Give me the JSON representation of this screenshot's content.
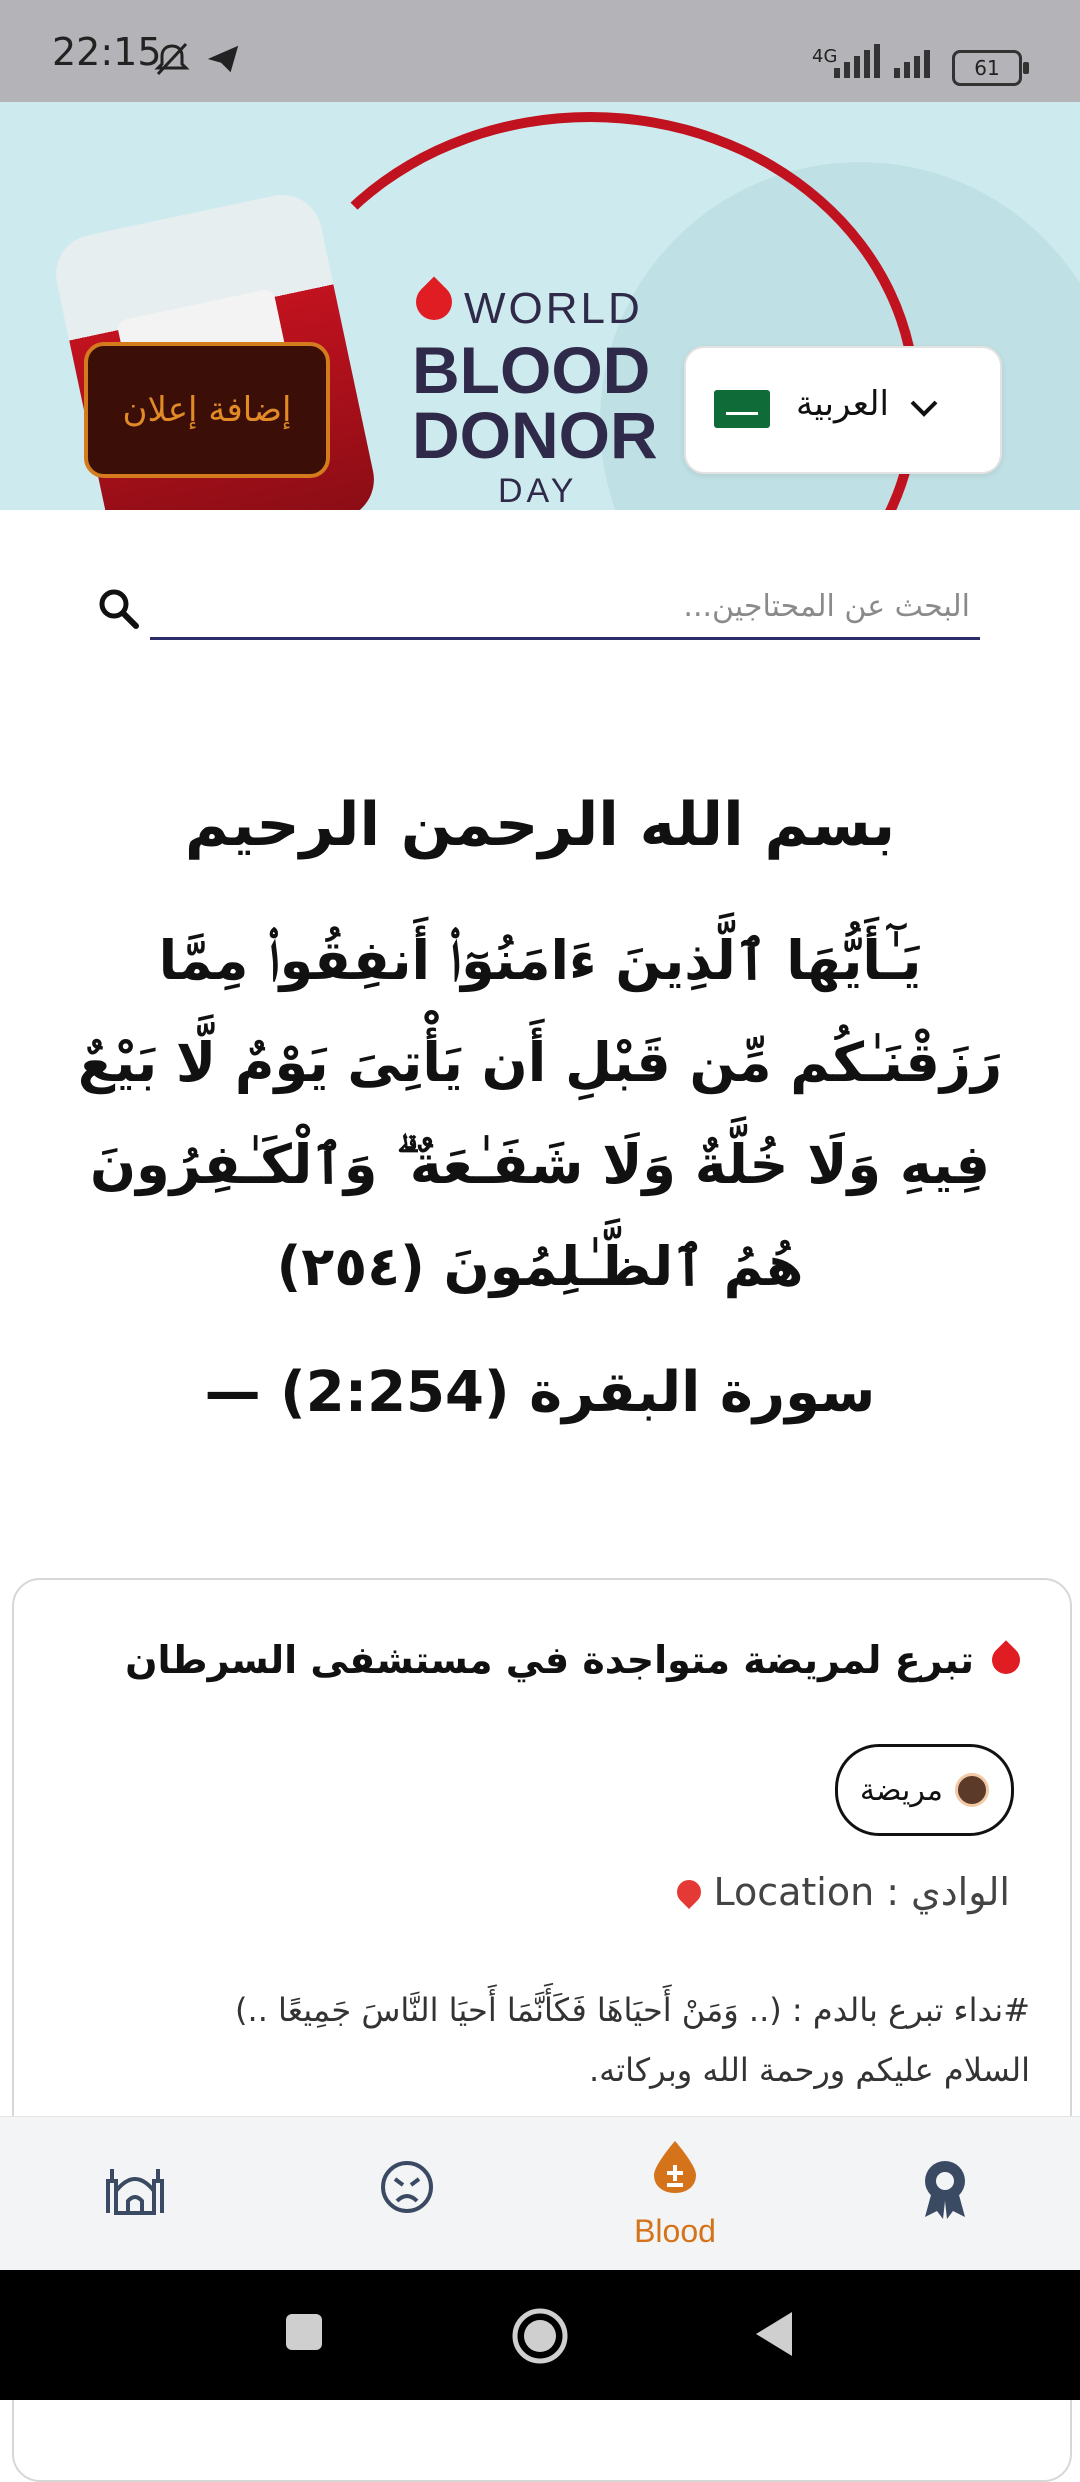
{
  "status_bar": {
    "time": "22:15",
    "network": "4G",
    "battery": "61"
  },
  "banner": {
    "add_ad_label": "إضافة إعلان",
    "language": "العربية",
    "logo": {
      "line1": "WORLD",
      "line2": "BLOOD",
      "line3": "DONOR",
      "line4": "DAY"
    }
  },
  "search": {
    "placeholder": "البحث عن المحتاجين..."
  },
  "verse": {
    "bismillah": "بسم الله الرحمن الرحيم",
    "text": "يَـٰٓأَيُّهَا ٱلَّذِينَ ءَامَنُوٓا۟ أَنفِقُوا۟ مِمَّا رَزَقْنَـٰكُم مِّن قَبْلِ أَن يَأْتِىَ يَوْمٌ لَّا بَيْعٌ فِيهِ وَلَا خُلَّةٌ وَلَا شَفَـٰعَةٌ ۗ وَٱلْكَـٰفِرُونَ هُمُ ٱلظَّـٰلِمُونَ (٢٥٤)",
    "reference": "سورة البقرة (2:254) —"
  },
  "post": {
    "title": "تبرع لمريضة متواجدة في مستشفى السرطان",
    "tag": "مريضة",
    "location_label": "Location",
    "location_value": "الوادي",
    "body_line1": "#نداء تبرع بالدم : (.. وَمَنْ أَحيَاهَا فَكَأَنَّمَا أَحيَا النَّاسَ جَمِيعًا ..)",
    "body_line2": "السلام عليكم ورحمة الله وبركاته."
  },
  "bottom_nav": {
    "items": [
      {
        "icon": "mosque-icon",
        "label": ""
      },
      {
        "icon": "sick-face-icon",
        "label": ""
      },
      {
        "icon": "blood-drop-icon",
        "label": "Blood",
        "active": true
      },
      {
        "icon": "award-icon",
        "label": ""
      }
    ],
    "active_color": "#d5731a",
    "inactive_color": "#3b4a63"
  }
}
